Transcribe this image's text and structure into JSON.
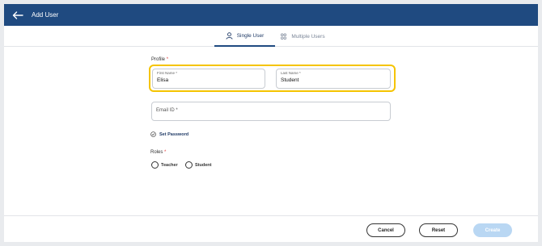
{
  "header": {
    "title": "Add User",
    "back_icon": "arrow-left-icon"
  },
  "tabs": [
    {
      "label": "Single User",
      "icon": "person-icon",
      "active": true
    },
    {
      "label": "Multiple Users",
      "icon": "group-icon",
      "active": false
    }
  ],
  "profile": {
    "label": "Profile",
    "required_marker": "*",
    "first_name": {
      "label": "First Name *",
      "value": "Elisa"
    },
    "last_name": {
      "label": "Last Name *",
      "value": "Student"
    },
    "email": {
      "placeholder": "Email ID *"
    }
  },
  "set_password": {
    "label": "Set Password",
    "icon": "check-circle-icon"
  },
  "roles": {
    "label": "Roles",
    "required_marker": "*",
    "options": [
      {
        "label": "Teacher",
        "selected": false
      },
      {
        "label": "Student",
        "selected": false
      }
    ]
  },
  "footer": {
    "cancel_label": "Cancel",
    "reset_label": "Reset",
    "create_label": "Create"
  },
  "colors": {
    "header_bg": "#1f4a80",
    "highlight": "#f5c400",
    "required": "#e23b3b",
    "create_disabled": "#b9d7f3"
  }
}
